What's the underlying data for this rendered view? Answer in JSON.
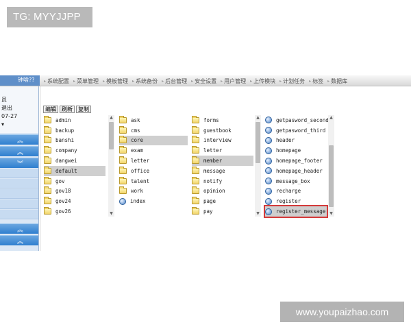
{
  "watermarks": {
    "top": "TG: MYYJJPP",
    "bottom": "www.youpaizhao.com"
  },
  "topnav": {
    "left_label": "钟啥??",
    "items": [
      "系统配置",
      "菜单管理",
      "模板管理",
      "系统备份",
      "后台管理",
      "安全设置",
      "用户管理",
      "上传模块",
      "计划任务",
      "标签",
      "数据库"
    ]
  },
  "leftpanel": {
    "lines": [
      "员",
      "退出",
      "07-27",
      "▾"
    ]
  },
  "toolbar": {
    "edit": "编辑",
    "refresh": "刷新",
    "copy": "复制"
  },
  "columns": [
    {
      "items": [
        {
          "name": "admin",
          "type": "folder"
        },
        {
          "name": "backup",
          "type": "folder"
        },
        {
          "name": "banshi",
          "type": "folder"
        },
        {
          "name": "company",
          "type": "folder"
        },
        {
          "name": "dangwei",
          "type": "folder"
        },
        {
          "name": "default",
          "type": "folder",
          "selected": true
        },
        {
          "name": "gov",
          "type": "folder"
        },
        {
          "name": "gov18",
          "type": "folder"
        },
        {
          "name": "gov24",
          "type": "folder"
        },
        {
          "name": "gov26",
          "type": "folder"
        }
      ]
    },
    {
      "items": [
        {
          "name": "ask",
          "type": "folder"
        },
        {
          "name": "cms",
          "type": "folder"
        },
        {
          "name": "core",
          "type": "folder",
          "selected": true
        },
        {
          "name": "exam",
          "type": "folder"
        },
        {
          "name": "letter",
          "type": "folder"
        },
        {
          "name": "office",
          "type": "folder"
        },
        {
          "name": "talent",
          "type": "folder"
        },
        {
          "name": "work",
          "type": "folder"
        },
        {
          "name": "index",
          "type": "file"
        }
      ]
    },
    {
      "items": [
        {
          "name": "forms",
          "type": "folder"
        },
        {
          "name": "guestbook",
          "type": "folder"
        },
        {
          "name": "interview",
          "type": "folder"
        },
        {
          "name": "letter",
          "type": "folder"
        },
        {
          "name": "member",
          "type": "folder",
          "selected": true
        },
        {
          "name": "message",
          "type": "folder"
        },
        {
          "name": "notify",
          "type": "folder"
        },
        {
          "name": "opinion",
          "type": "folder"
        },
        {
          "name": "page",
          "type": "folder"
        },
        {
          "name": "pay",
          "type": "folder"
        }
      ]
    },
    {
      "items": [
        {
          "name": "getpasword_second",
          "type": "file"
        },
        {
          "name": "getpasword_third",
          "type": "file"
        },
        {
          "name": "header",
          "type": "file"
        },
        {
          "name": "homepage",
          "type": "file"
        },
        {
          "name": "homepage_footer",
          "type": "file"
        },
        {
          "name": "homepage_header",
          "type": "file"
        },
        {
          "name": "message_box",
          "type": "file"
        },
        {
          "name": "recharge",
          "type": "file"
        },
        {
          "name": "register",
          "type": "file"
        },
        {
          "name": "register_message",
          "type": "file",
          "selected": true,
          "boxed": true
        }
      ]
    }
  ],
  "colors": {
    "nav_blue": "#2f7fcf",
    "selection": "#cfcfcf",
    "highlight_box": "#d43a3a"
  }
}
